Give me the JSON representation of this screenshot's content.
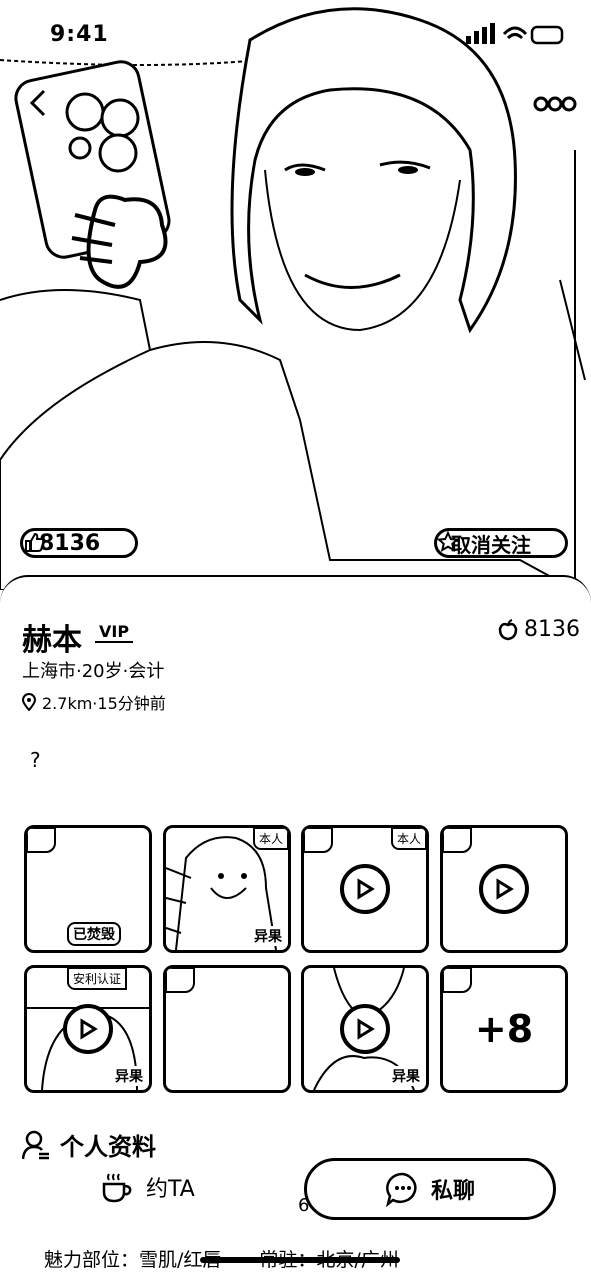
{
  "status_bar": {
    "time": "9:41"
  },
  "hero": {
    "like_count": "8136",
    "unfollow_label": "取消关注"
  },
  "profile": {
    "name": "赫本",
    "vip_label": "VIP",
    "likes": "8136",
    "meta": "上海市·20岁·会计",
    "location": "2.7km·15分钟前",
    "bio": "?"
  },
  "gallery": {
    "destroyed_label": "已焚毁",
    "self_label": "本人",
    "verified_label": "安利认证",
    "eval_label": "异果",
    "more_label": "+8"
  },
  "section": {
    "profile_title": "个人资料"
  },
  "actions": {
    "date_label": "约TA",
    "chat_label": "私聊",
    "count": "6"
  },
  "details": {
    "charm_line": "魅力部位：雪肌/红唇　　常驻：北京/广州"
  }
}
